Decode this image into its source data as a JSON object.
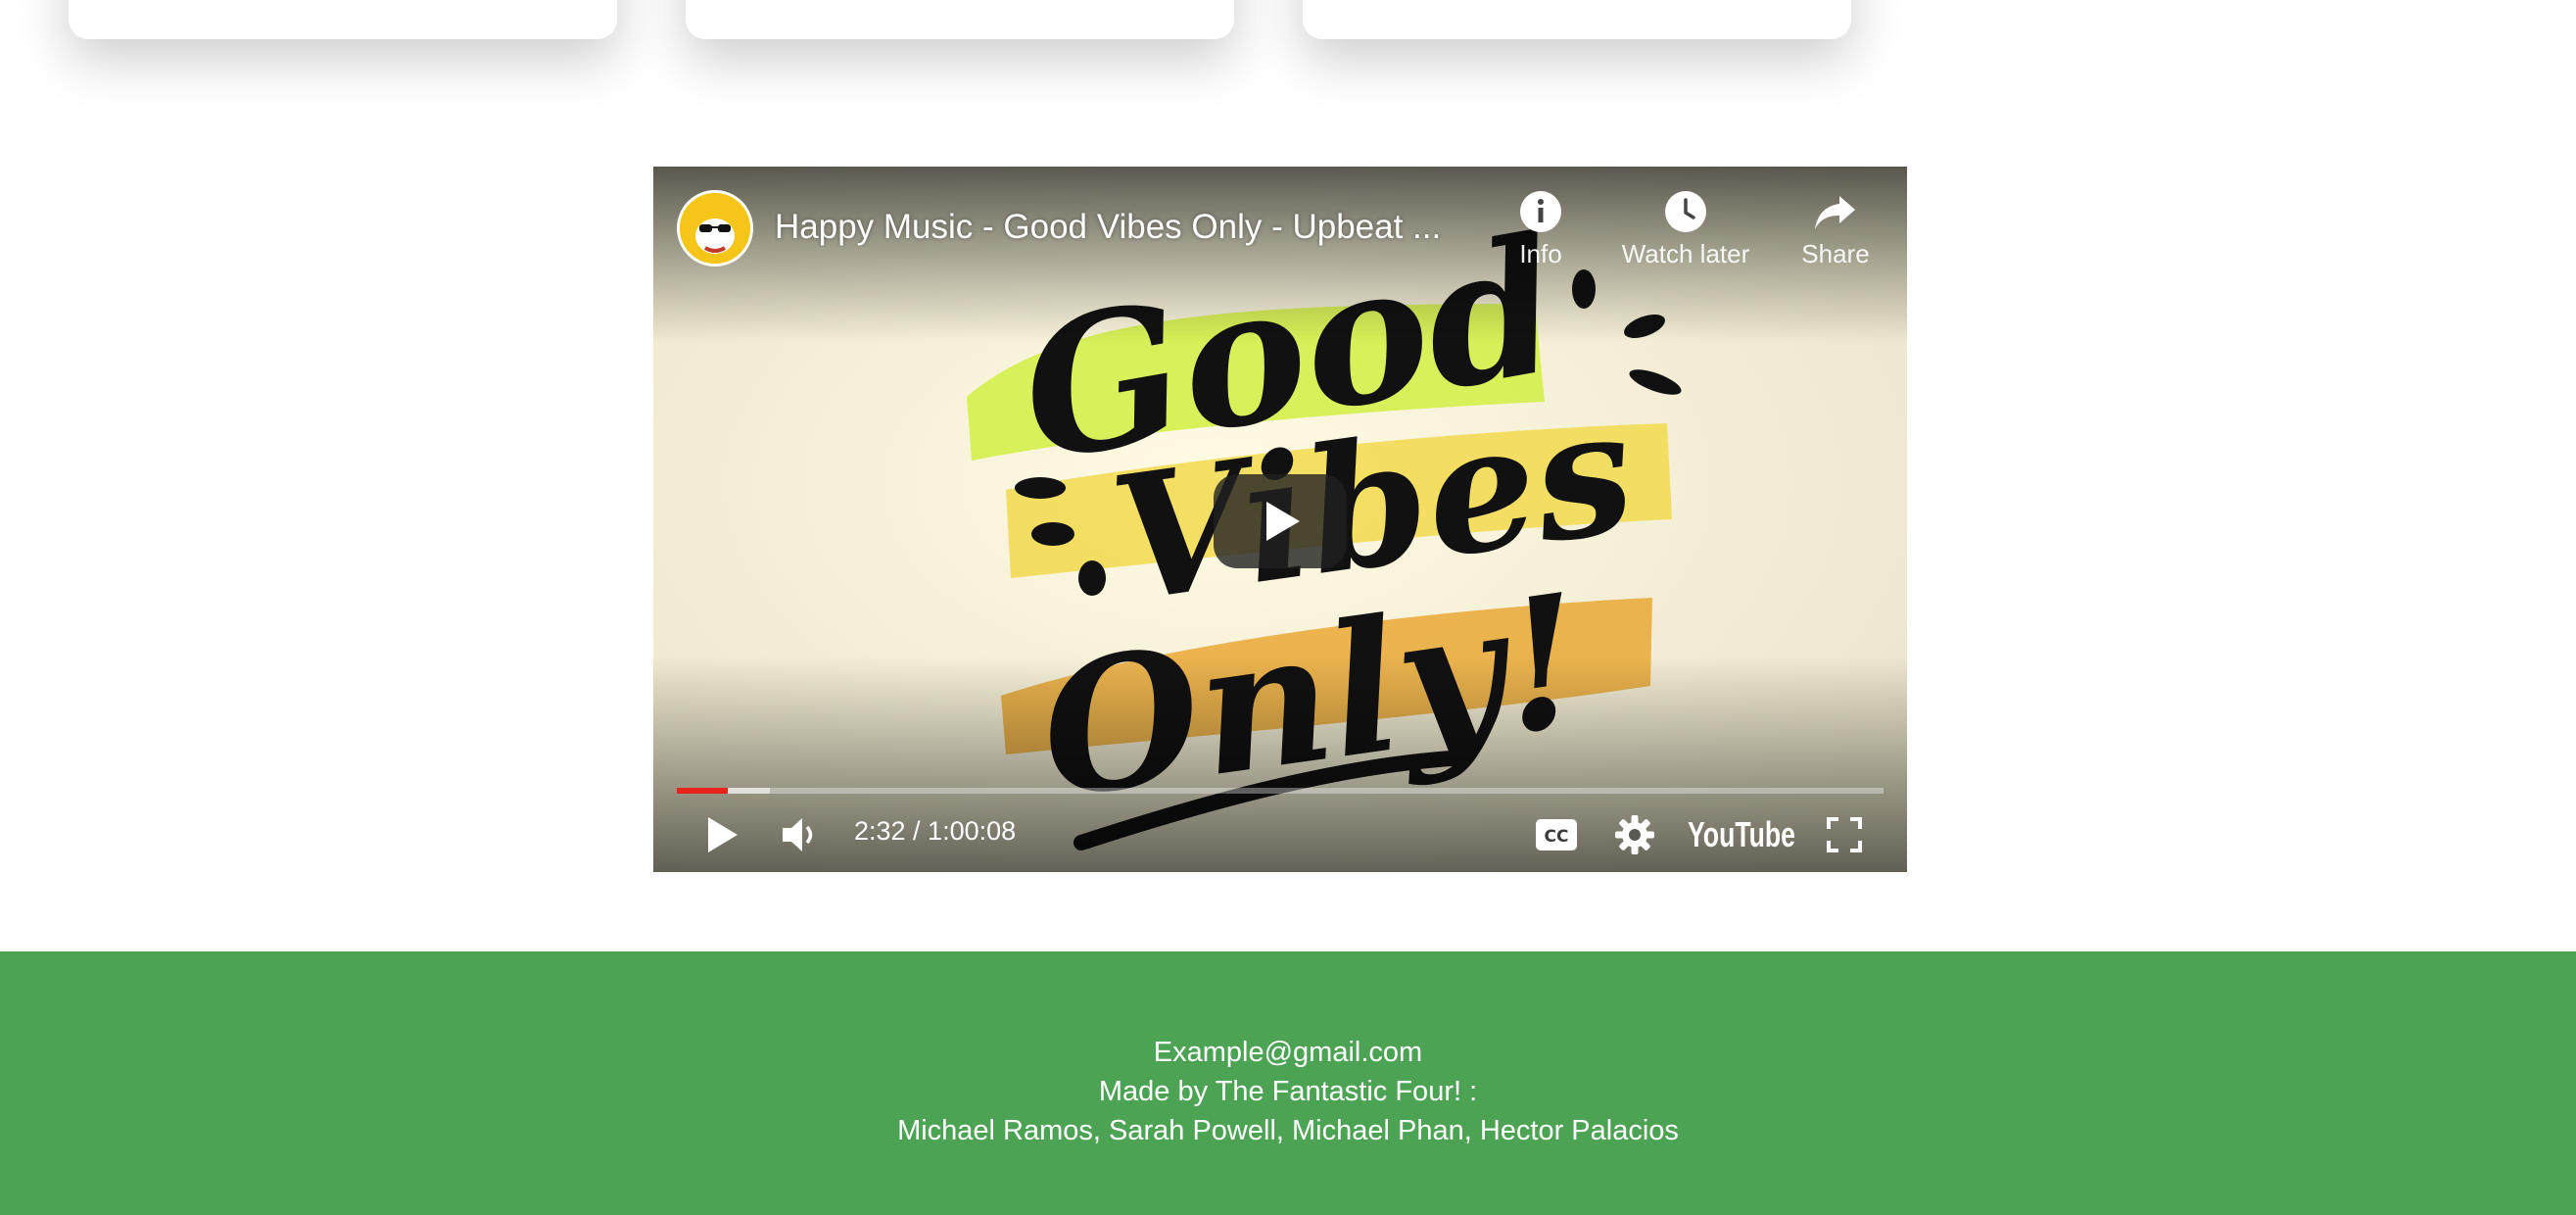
{
  "video": {
    "title": "Happy Music - Good Vibes Only - Upbeat ...",
    "actions": {
      "info": "Info",
      "watch_later": "Watch later",
      "share": "Share"
    },
    "time_display": "2:32 / 1:00:08",
    "progress_played_fraction": 0.042,
    "progress_buffered_fraction": 0.077,
    "thumbnail_text": [
      "Good",
      "Vibes",
      "Only!"
    ],
    "logo_text": "YouTube",
    "accent_color": "#e8231c"
  },
  "footer": {
    "email": "Example@gmail.com",
    "made_by": "Made by The Fantastic Four! :",
    "members": "Michael Ramos, Sarah Powell, Michael Phan, Hector Palacios",
    "background": "#4ca353"
  }
}
